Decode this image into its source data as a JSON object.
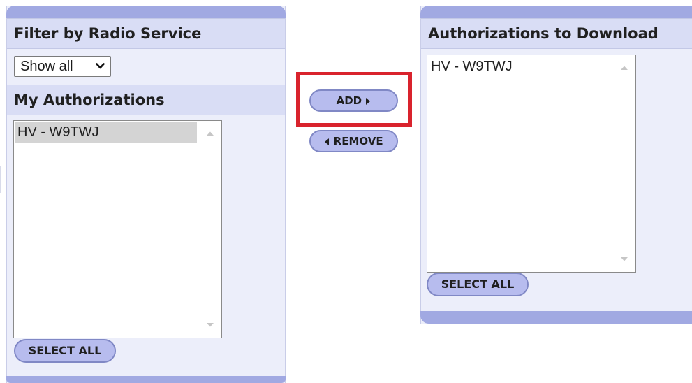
{
  "left_panel": {
    "filter_header": "Filter by Radio Service",
    "filter_select": {
      "selected": "Show all"
    },
    "my_auth_header": "My Authorizations",
    "list_items": [
      "HV - W9TWJ"
    ],
    "select_all_label": "SELECT ALL"
  },
  "middle": {
    "add_label": "ADD",
    "remove_label": "REMOVE"
  },
  "right_panel": {
    "header": "Authorizations to Download",
    "list_items": [
      "HV - W9TWJ"
    ],
    "select_all_label": "SELECT ALL"
  },
  "icons": {
    "dropdown": "chevron-down-icon",
    "add": "triangle-right-icon",
    "remove": "triangle-left-icon",
    "scroll_up": "scroll-up-arrow-icon",
    "scroll_down": "scroll-down-arrow-icon"
  },
  "colors": {
    "panel_cap": "#a1a9e2",
    "panel_bg": "#eceefa",
    "header_bg": "#d9ddf5",
    "button_bg": "#b7bcee",
    "selected_item_bg": "#d4d4d4",
    "highlight": "#d9232d"
  }
}
